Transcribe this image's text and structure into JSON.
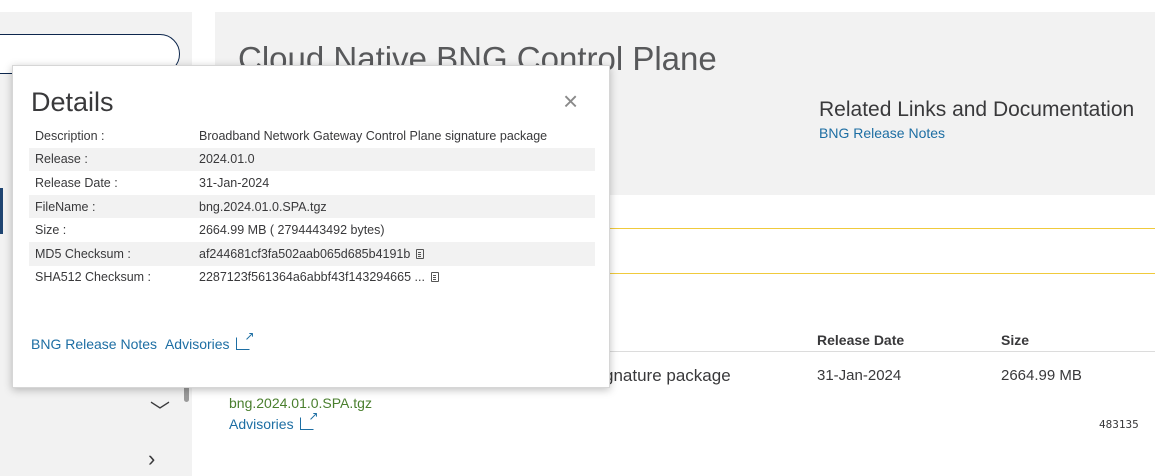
{
  "hero": {
    "title": "Cloud Native BNG Control Plane",
    "related_title": "Related Links and Documentation",
    "related_link": "BNG Release Notes"
  },
  "table": {
    "headers": {
      "release_date": "Release Date",
      "size": "Size"
    },
    "row": {
      "description_tail": "gnature package",
      "release_date": "31-Jan-2024",
      "size": "2664.99 MB",
      "filename": "bng.2024.01.0.SPA.tgz",
      "advisories": "Advisories",
      "id": "483135"
    }
  },
  "details": {
    "title": "Details",
    "close": "×",
    "rows": [
      {
        "key": "Description :",
        "value": "Broadband Network Gateway Control Plane signature package"
      },
      {
        "key": "Release :",
        "value": "2024.01.0"
      },
      {
        "key": "Release Date :",
        "value": "31-Jan-2024"
      },
      {
        "key": "FileName :",
        "value": "bng.2024.01.0.SPA.tgz"
      },
      {
        "key": "Size :",
        "value": "2664.99 MB ( 2794443492 bytes)"
      },
      {
        "key": "MD5 Checksum :",
        "value": "af244681cf3fa502aab065d685b4191b"
      },
      {
        "key": "SHA512 Checksum :",
        "value": "2287123f561364a6abbf43f143294665 ..."
      }
    ],
    "links": {
      "release_notes": "BNG Release Notes",
      "advisories": "Advisories"
    }
  },
  "icons": {
    "close": "close-icon",
    "copy": "copy-icon",
    "external": "external-link-icon",
    "chevron_down": "chevron-down-icon",
    "chevron_right": "chevron-right-icon"
  }
}
